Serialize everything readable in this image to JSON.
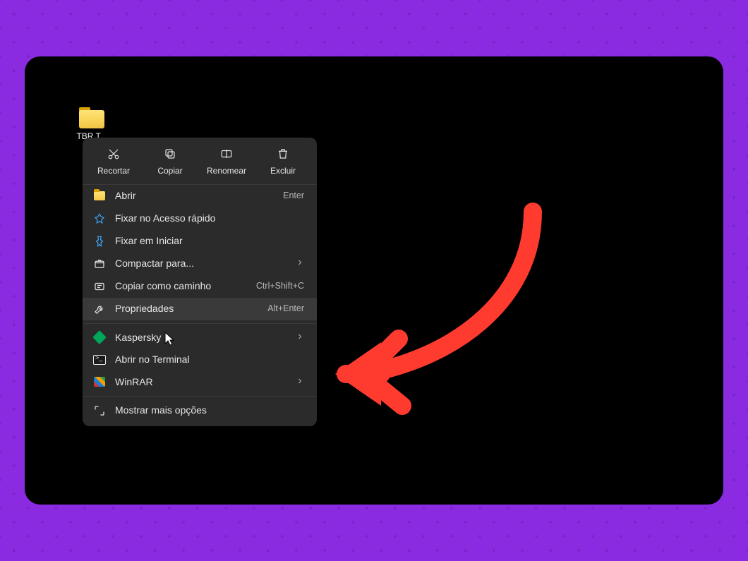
{
  "desktop": {
    "folder_label": "TBR T..."
  },
  "context_menu": {
    "topbar": {
      "cut": "Recortar",
      "copy": "Copiar",
      "rename": "Renomear",
      "delete": "Excluir"
    },
    "items": [
      {
        "label": "Abrir",
        "shortcut": "Enter",
        "submenu": false
      },
      {
        "label": "Fixar no Acesso rápido",
        "shortcut": "",
        "submenu": false
      },
      {
        "label": "Fixar em Iniciar",
        "shortcut": "",
        "submenu": false
      },
      {
        "label": "Compactar para...",
        "shortcut": "",
        "submenu": true
      },
      {
        "label": "Copiar como caminho",
        "shortcut": "Ctrl+Shift+C",
        "submenu": false
      },
      {
        "label": "Propriedades",
        "shortcut": "Alt+Enter",
        "submenu": false
      }
    ],
    "group2": [
      {
        "label": "Kaspersky",
        "submenu": true
      },
      {
        "label": "Abrir no Terminal",
        "submenu": false
      },
      {
        "label": "WinRAR",
        "submenu": true
      }
    ],
    "more_options": "Mostrar mais opções",
    "highlight_index": 5
  },
  "annotation": {
    "arrow_color": "#ff3b30"
  }
}
